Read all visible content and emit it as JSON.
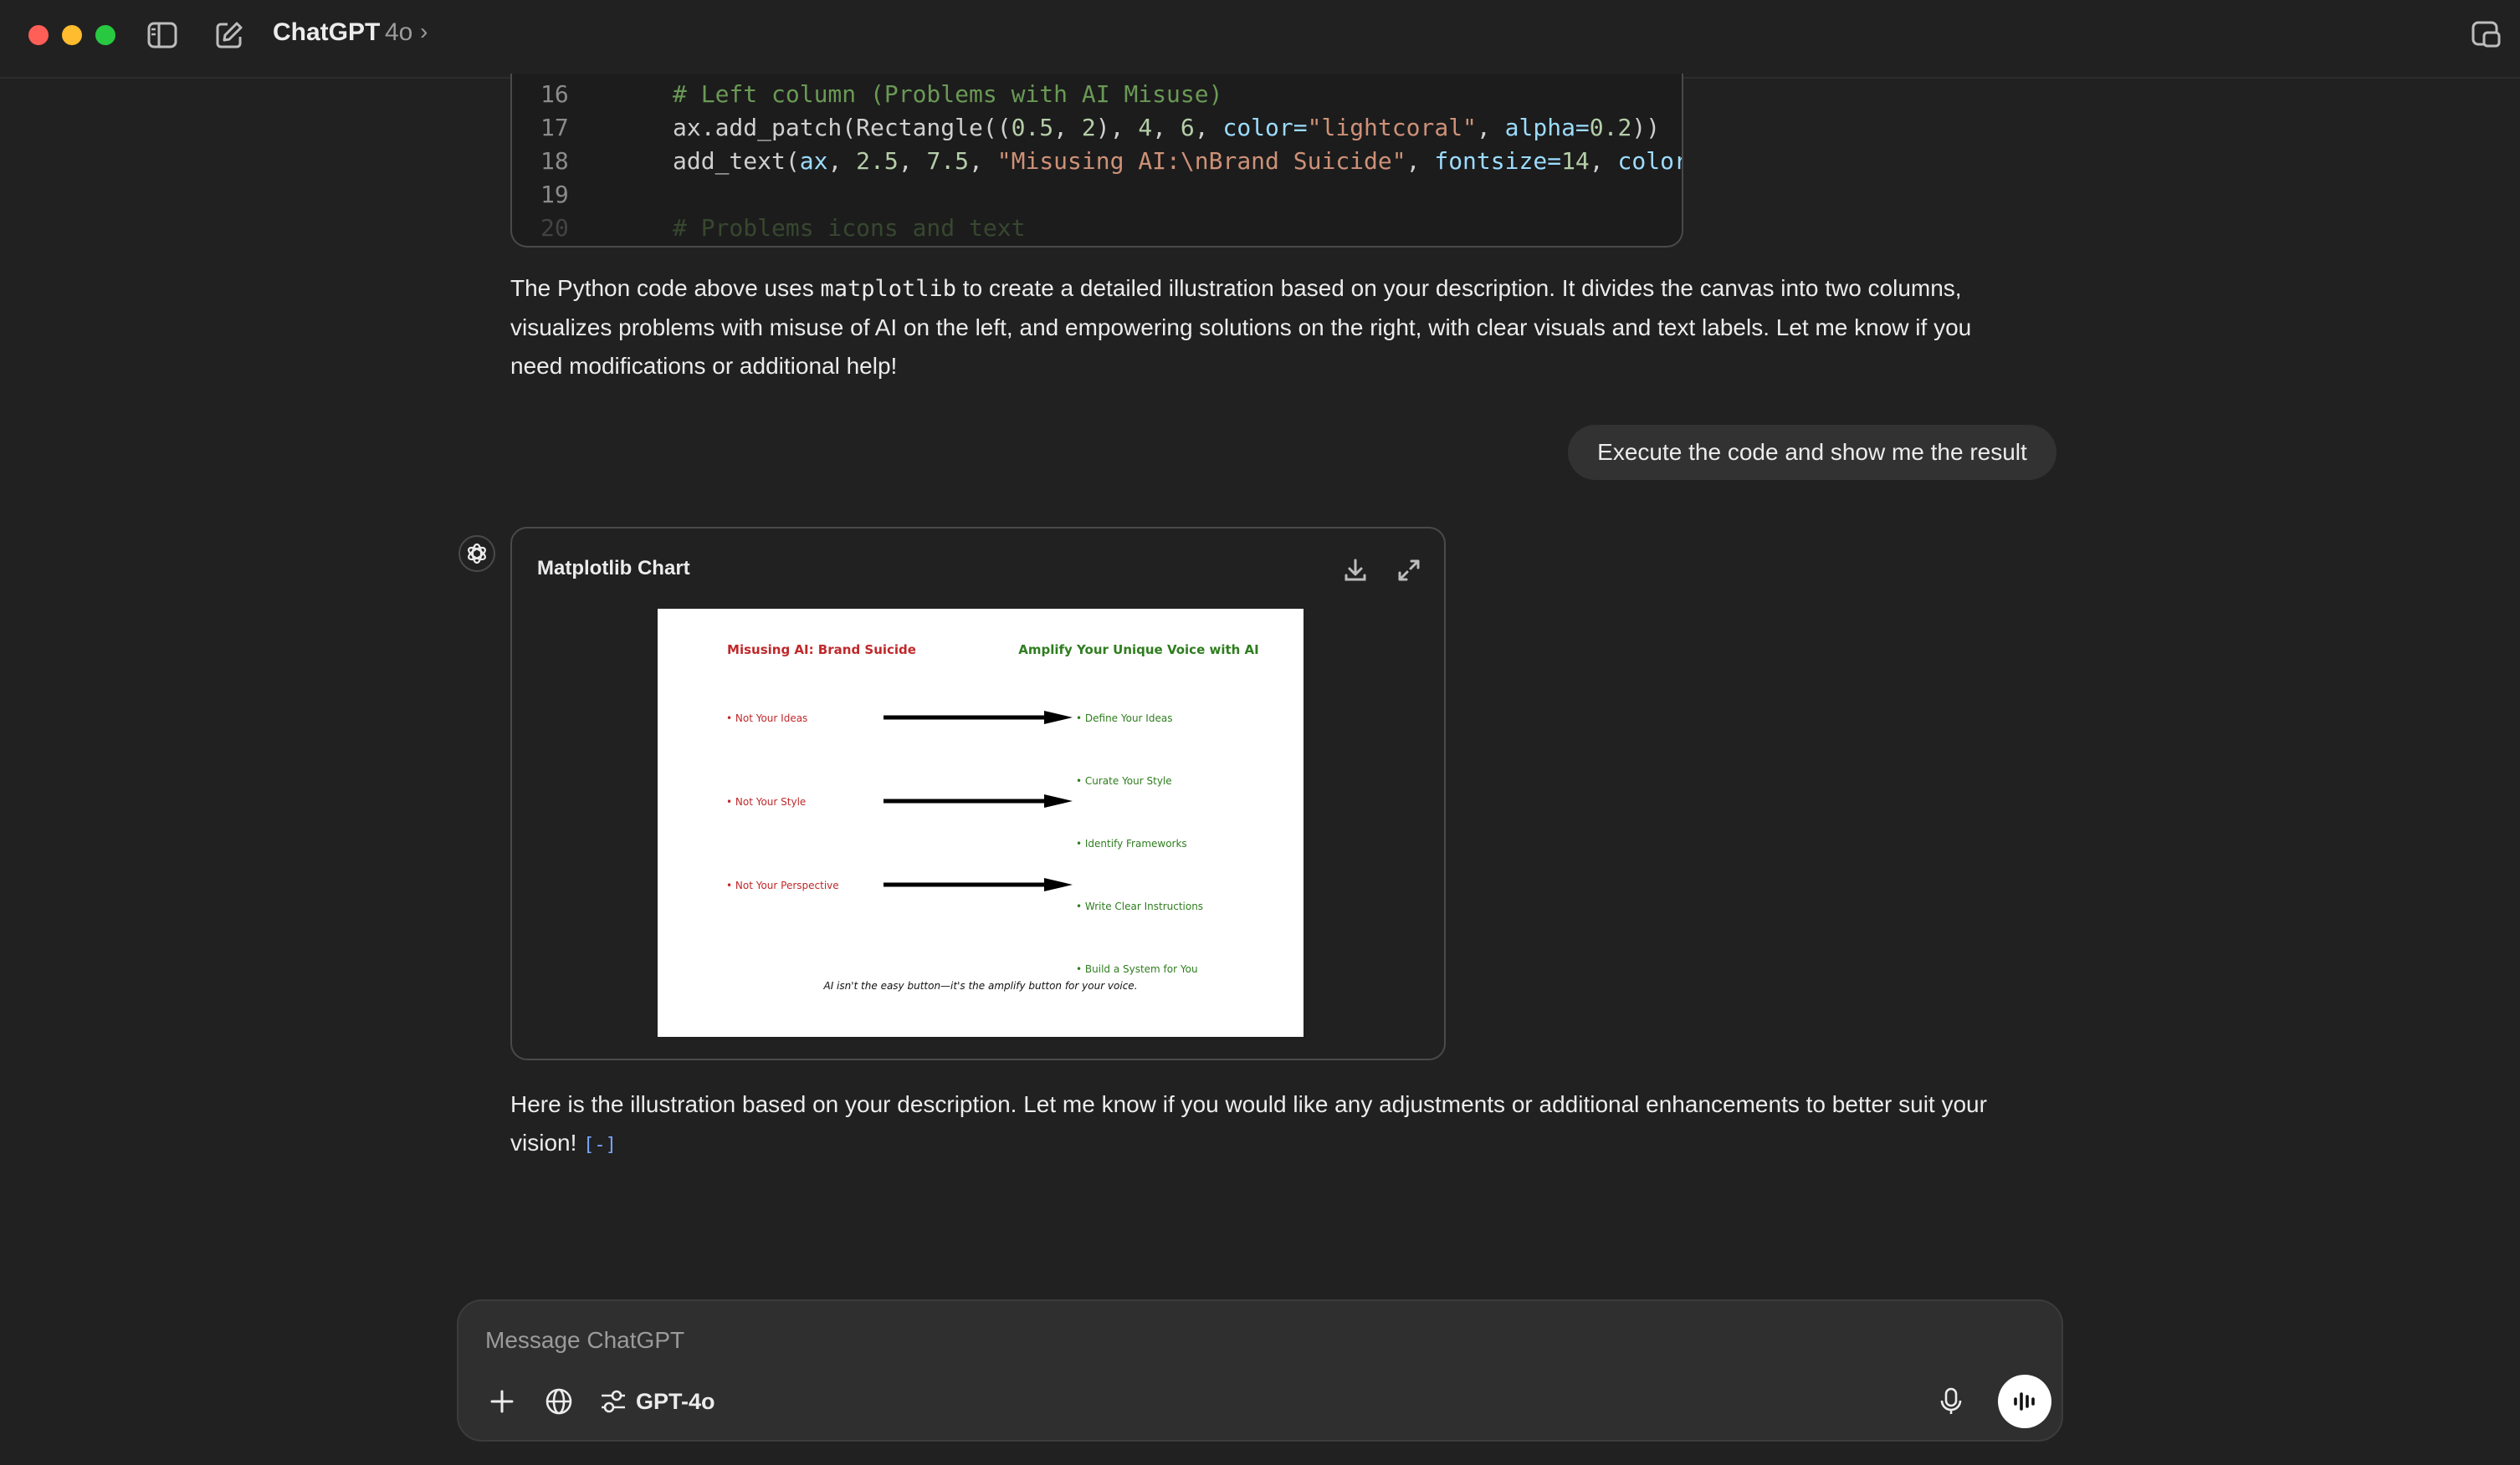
{
  "window": {
    "app_title": "ChatGPT",
    "model_badge": "4o",
    "chevron": "›"
  },
  "code": {
    "lines": [
      {
        "n": "16",
        "segments": [
          {
            "t": "# Left column (Problems with AI Misuse)",
            "c": "c-comment"
          }
        ]
      },
      {
        "n": "17",
        "segments": [
          {
            "t": "ax.add_patch(Rectangle((",
            "c": "c-plain"
          },
          {
            "t": "0.5",
            "c": "c-num"
          },
          {
            "t": ", ",
            "c": "c-plain"
          },
          {
            "t": "2",
            "c": "c-num"
          },
          {
            "t": "), ",
            "c": "c-plain"
          },
          {
            "t": "4",
            "c": "c-num"
          },
          {
            "t": ", ",
            "c": "c-plain"
          },
          {
            "t": "6",
            "c": "c-num"
          },
          {
            "t": ", ",
            "c": "c-plain"
          },
          {
            "t": "color=",
            "c": "c-kw"
          },
          {
            "t": "\"lightcoral\"",
            "c": "c-str"
          },
          {
            "t": ", ",
            "c": "c-plain"
          },
          {
            "t": "alpha=",
            "c": "c-kw"
          },
          {
            "t": "0.2",
            "c": "c-num"
          },
          {
            "t": "))",
            "c": "c-plain"
          }
        ]
      },
      {
        "n": "18",
        "segments": [
          {
            "t": "add_text(",
            "c": "c-plain"
          },
          {
            "t": "ax",
            "c": "c-kw"
          },
          {
            "t": ", ",
            "c": "c-plain"
          },
          {
            "t": "2.5",
            "c": "c-num"
          },
          {
            "t": ", ",
            "c": "c-plain"
          },
          {
            "t": "7.5",
            "c": "c-num"
          },
          {
            "t": ", ",
            "c": "c-plain"
          },
          {
            "t": "\"Misusing AI:\\nBrand Suicide\"",
            "c": "c-str"
          },
          {
            "t": ", ",
            "c": "c-plain"
          },
          {
            "t": "fontsize=",
            "c": "c-kw"
          },
          {
            "t": "14",
            "c": "c-num"
          },
          {
            "t": ", ",
            "c": "c-plain"
          },
          {
            "t": "color",
            "c": "c-kw"
          }
        ]
      },
      {
        "n": "19",
        "segments": []
      },
      {
        "n": "20",
        "segments": [
          {
            "t": "# Problems icons and text",
            "c": "c-comment"
          }
        ]
      }
    ]
  },
  "messages": {
    "assistant_1_pre": "The Python code above uses ",
    "assistant_1_code": "matplotlib",
    "assistant_1_post": " to create a detailed illustration based on your description. It divides the canvas into two columns, visualizes problems with misuse of AI on the left, and empowering solutions on the right, with clear visuals and text labels. Let me know if you need modifications or additional help!",
    "user_1": "Execute the code and show me the result",
    "assistant_2": "Here is the illustration based on your description. Let me know if you would like any adjustments or additional enhancements to better suit your vision!",
    "assistant_2_citation": "[-]"
  },
  "chart_card": {
    "title": "Matplotlib Chart",
    "image": {
      "left_heading": "Misusing AI: Brand Suicide",
      "right_heading": "Amplify Your Unique Voice with AI",
      "left_items": [
        "• Not Your Ideas",
        "• Not Your Style",
        "• Not Your Perspective"
      ],
      "right_items": [
        "• Define Your Ideas",
        "• Curate Your Style",
        "• Identify Frameworks",
        "• Write Clear Instructions",
        "• Build a System for You"
      ],
      "footer": "AI isn't the easy button—it's the amplify button for your voice.",
      "colors": {
        "left": "#c0282a",
        "right": "#2f7d1f",
        "arrow": "#000000"
      }
    }
  },
  "composer": {
    "placeholder": "Message ChatGPT",
    "model_label": "GPT-4o"
  },
  "icons": {
    "sidebar": "sidebar-toggle-icon",
    "new_chat": "new-chat-icon",
    "window": "window-icon",
    "download": "download-icon",
    "expand": "expand-icon",
    "plus": "plus-icon",
    "globe": "globe-icon",
    "tools": "tools-icon",
    "mic": "mic-icon",
    "voice": "voice-mode-icon"
  }
}
